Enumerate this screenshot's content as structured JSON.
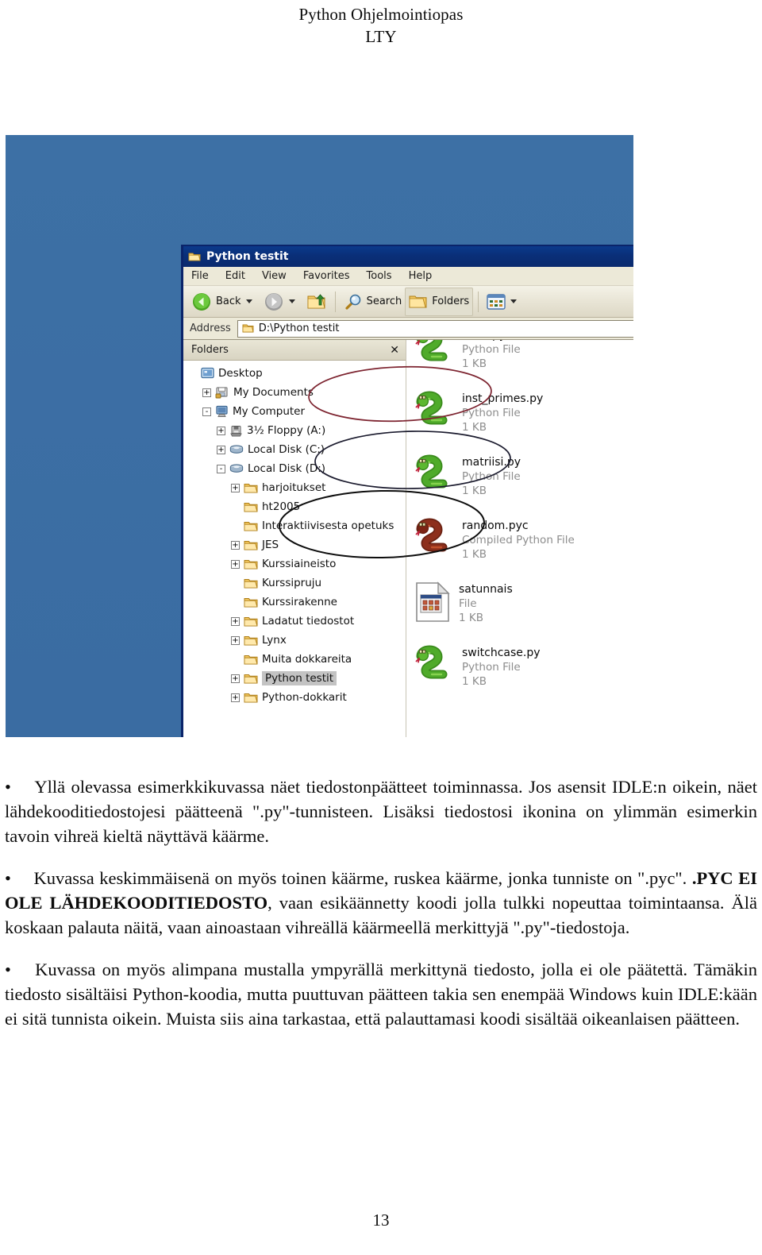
{
  "document": {
    "header_line1": "Python Ohjelmointiopas",
    "header_line2": "LTY",
    "page_number": "13"
  },
  "figure": {
    "desktop_color": "#3a6ea5",
    "explorer": {
      "titlebar": {
        "title": "Python testit",
        "icon": "folder-icon"
      },
      "menubar": {
        "items": [
          {
            "label": "File"
          },
          {
            "label": "Edit"
          },
          {
            "label": "View"
          },
          {
            "label": "Favorites"
          },
          {
            "label": "Tools"
          },
          {
            "label": "Help"
          }
        ]
      },
      "toolbar": {
        "back_label": "Back",
        "search_label": "Search",
        "folders_label": "Folders",
        "icons": [
          "back-arrow-icon",
          "forward-arrow-icon",
          "up-folder-icon",
          "search-magnifier-icon",
          "folders-icon",
          "views-icon"
        ]
      },
      "address": {
        "label": "Address",
        "value": "D:\\Python testit",
        "icon": "folder-icon"
      },
      "tree": {
        "header_label": "Folders",
        "close_label": "✕",
        "nodes": [
          {
            "label": "Desktop",
            "indent": 0,
            "expander": "",
            "icon": "desktop-icon",
            "selected": false
          },
          {
            "label": "My Documents",
            "indent": 1,
            "expander": "+",
            "icon": "documents-icon",
            "selected": false
          },
          {
            "label": "My Computer",
            "indent": 1,
            "expander": "-",
            "icon": "computer-icon",
            "selected": false
          },
          {
            "label": "3½ Floppy (A:)",
            "indent": 2,
            "expander": "+",
            "icon": "floppy-icon",
            "selected": false
          },
          {
            "label": "Local Disk (C:)",
            "indent": 2,
            "expander": "+",
            "icon": "harddisk-icon",
            "selected": false
          },
          {
            "label": "Local Disk (D:)",
            "indent": 2,
            "expander": "-",
            "icon": "harddisk-icon",
            "selected": false
          },
          {
            "label": "harjoitukset",
            "indent": 3,
            "expander": "+",
            "icon": "folder-icon",
            "selected": false
          },
          {
            "label": "ht2005",
            "indent": 3,
            "expander": "",
            "icon": "folder-icon",
            "selected": false
          },
          {
            "label": "Interaktiivisesta opetuks",
            "indent": 3,
            "expander": "",
            "icon": "folder-icon",
            "selected": false
          },
          {
            "label": "JES",
            "indent": 3,
            "expander": "+",
            "icon": "folder-icon",
            "selected": false
          },
          {
            "label": "Kurssiaineisto",
            "indent": 3,
            "expander": "+",
            "icon": "folder-icon",
            "selected": false
          },
          {
            "label": "Kurssipruju",
            "indent": 3,
            "expander": "",
            "icon": "folder-icon",
            "selected": false
          },
          {
            "label": "Kurssirakenne",
            "indent": 3,
            "expander": "",
            "icon": "folder-icon",
            "selected": false
          },
          {
            "label": "Ladatut tiedostot",
            "indent": 3,
            "expander": "+",
            "icon": "folder-icon",
            "selected": false
          },
          {
            "label": "Lynx",
            "indent": 3,
            "expander": "+",
            "icon": "folder-icon",
            "selected": false
          },
          {
            "label": "Muita dokkareita",
            "indent": 3,
            "expander": "",
            "icon": "folder-icon",
            "selected": false
          },
          {
            "label": "Python testit",
            "indent": 3,
            "expander": "+",
            "icon": "folder-icon",
            "selected": true
          },
          {
            "label": "Python-dokkarit",
            "indent": 3,
            "expander": "+",
            "icon": "folder-icon",
            "selected": false
          }
        ]
      },
      "files": [
        {
          "name": "hello.py",
          "type": "Python File",
          "size": "1 KB",
          "icon": "green-snake-icon",
          "annotated": "none"
        },
        {
          "name": "inst_primes.py",
          "type": "Python File",
          "size": "1 KB",
          "icon": "green-snake-icon",
          "annotated": "none"
        },
        {
          "name": "matriisi.py",
          "type": "Python File",
          "size": "1 KB",
          "icon": "green-snake-icon",
          "annotated": "red-ellipse"
        },
        {
          "name": "random.pyc",
          "type": "Compiled Python File",
          "size": "1 KB",
          "icon": "brown-snake-icon",
          "annotated": "dark-ellipse"
        },
        {
          "name": "satunnais",
          "type": "File",
          "size": "1 KB",
          "icon": "generic-file-icon",
          "annotated": "black-ellipse"
        },
        {
          "name": "switchcase.py",
          "type": "Python File",
          "size": "1 KB",
          "icon": "green-snake-icon",
          "annotated": "none"
        }
      ]
    }
  },
  "body": {
    "bullets": [
      {
        "marker": "•",
        "text": "Yllä olevassa esimerkkikuvassa näet tiedostonpäätteet toiminnassa. Jos asensit IDLE:n oikein, näet lähdekooditiedostojesi päätteenä \".py\"-tunnisteen. Lisäksi tiedostosi ikonina on ylimmän esimerkin tavoin vihreä kieltä näyttävä käärme."
      },
      {
        "marker": "•",
        "text_before": "Kuvassa keskimmäisenä on myös toinen käärme, ruskea käärme, jonka tunniste on \".pyc\". ",
        "text_bold": ".PYC EI OLE LÄHDEKOODITIEDOSTO",
        "text_after": ", vaan esikäännetty koodi jolla tulkki nopeuttaa toimintaansa. Älä koskaan palauta näitä, vaan ainoastaan vihreällä käärmeellä merkittyjä \".py\"-tiedostoja."
      },
      {
        "marker": "•",
        "text": "Kuvassa on myös alimpana mustalla ympyrällä merkittynä tiedosto, jolla ei ole päätettä. Tämäkin tiedosto sisältäisi Python-koodia, mutta puuttuvan päätteen takia sen enempää Windows kuin IDLE:kään ei sitä tunnista oikein. Muista siis aina tarkastaa, että palauttamasi koodi sisältää oikeanlaisen päätteen."
      }
    ]
  }
}
